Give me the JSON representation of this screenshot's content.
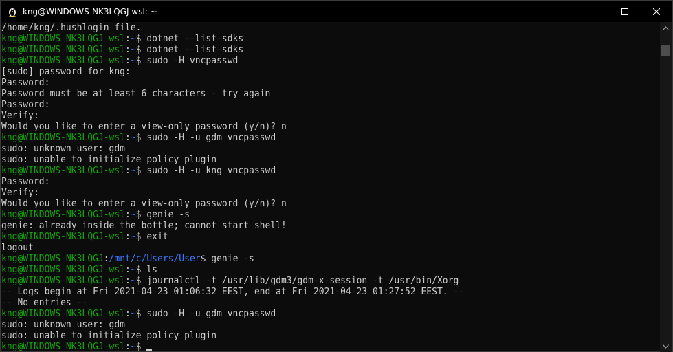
{
  "window": {
    "title": "kng@WINDOWS-NK3LQGJ-wsl: ~",
    "icon": "tux-penguin-icon"
  },
  "caption": {
    "minimize_icon": "minimize-icon",
    "maximize_icon": "maximize-icon",
    "close_icon": "close-icon"
  },
  "terminal": {
    "lines": [
      {
        "segments": [
          {
            "c": "t",
            "text": "/home/kng/.hushlogin file."
          }
        ]
      },
      {
        "segments": [
          {
            "c": "u",
            "text": "kng@WINDOWS-NK3LQGJ-wsl"
          },
          {
            "c": "t",
            "text": ":"
          },
          {
            "c": "p",
            "text": "~"
          },
          {
            "c": "t",
            "text": "$ dotnet --list-sdks"
          }
        ]
      },
      {
        "segments": [
          {
            "c": "u",
            "text": "kng@WINDOWS-NK3LQGJ-wsl"
          },
          {
            "c": "t",
            "text": ":"
          },
          {
            "c": "p",
            "text": "~"
          },
          {
            "c": "t",
            "text": "$ dotnet --list-sdks"
          }
        ]
      },
      {
        "segments": [
          {
            "c": "u",
            "text": "kng@WINDOWS-NK3LQGJ-wsl"
          },
          {
            "c": "t",
            "text": ":"
          },
          {
            "c": "p",
            "text": "~"
          },
          {
            "c": "t",
            "text": "$ sudo -H vncpasswd"
          }
        ]
      },
      {
        "segments": [
          {
            "c": "t",
            "text": "[sudo] password for kng:"
          }
        ]
      },
      {
        "segments": [
          {
            "c": "t",
            "text": "Password:"
          }
        ]
      },
      {
        "segments": [
          {
            "c": "t",
            "text": "Password must be at least 6 characters - try again"
          }
        ]
      },
      {
        "segments": [
          {
            "c": "t",
            "text": "Password:"
          }
        ]
      },
      {
        "segments": [
          {
            "c": "t",
            "text": "Verify:"
          }
        ]
      },
      {
        "segments": [
          {
            "c": "t",
            "text": "Would you like to enter a view-only password (y/n)? n"
          }
        ]
      },
      {
        "segments": [
          {
            "c": "u",
            "text": "kng@WINDOWS-NK3LQGJ-wsl"
          },
          {
            "c": "t",
            "text": ":"
          },
          {
            "c": "p",
            "text": "~"
          },
          {
            "c": "t",
            "text": "$ sudo -H -u gdm vncpasswd"
          }
        ]
      },
      {
        "segments": [
          {
            "c": "t",
            "text": "sudo: unknown user: gdm"
          }
        ]
      },
      {
        "segments": [
          {
            "c": "t",
            "text": "sudo: unable to initialize policy plugin"
          }
        ]
      },
      {
        "segments": [
          {
            "c": "u",
            "text": "kng@WINDOWS-NK3LQGJ-wsl"
          },
          {
            "c": "t",
            "text": ":"
          },
          {
            "c": "p",
            "text": "~"
          },
          {
            "c": "t",
            "text": "$ sudo -H -u kng vncpasswd"
          }
        ]
      },
      {
        "segments": [
          {
            "c": "t",
            "text": "Password:"
          }
        ]
      },
      {
        "segments": [
          {
            "c": "t",
            "text": "Verify:"
          }
        ]
      },
      {
        "segments": [
          {
            "c": "t",
            "text": "Would you like to enter a view-only password (y/n)? n"
          }
        ]
      },
      {
        "segments": [
          {
            "c": "u",
            "text": "kng@WINDOWS-NK3LQGJ-wsl"
          },
          {
            "c": "t",
            "text": ":"
          },
          {
            "c": "p",
            "text": "~"
          },
          {
            "c": "t",
            "text": "$ genie -s"
          }
        ]
      },
      {
        "segments": [
          {
            "c": "t",
            "text": "genie: already inside the bottle; cannot start shell!"
          }
        ]
      },
      {
        "segments": [
          {
            "c": "u",
            "text": "kng@WINDOWS-NK3LQGJ-wsl"
          },
          {
            "c": "t",
            "text": ":"
          },
          {
            "c": "p",
            "text": "~"
          },
          {
            "c": "t",
            "text": "$ exit"
          }
        ]
      },
      {
        "segments": [
          {
            "c": "t",
            "text": "logout"
          }
        ]
      },
      {
        "segments": [
          {
            "c": "u",
            "text": "kng@WINDOWS-NK3LQGJ"
          },
          {
            "c": "t",
            "text": ":"
          },
          {
            "c": "p",
            "text": "/mnt/c/Users/User"
          },
          {
            "c": "t",
            "text": "$ genie -s"
          }
        ]
      },
      {
        "segments": [
          {
            "c": "u",
            "text": "kng@WINDOWS-NK3LQGJ-wsl"
          },
          {
            "c": "t",
            "text": ":"
          },
          {
            "c": "p",
            "text": "~"
          },
          {
            "c": "t",
            "text": "$ ls"
          }
        ]
      },
      {
        "segments": [
          {
            "c": "u",
            "text": "kng@WINDOWS-NK3LQGJ-wsl"
          },
          {
            "c": "t",
            "text": ":"
          },
          {
            "c": "p",
            "text": "~"
          },
          {
            "c": "t",
            "text": "$ journalctl -t /usr/lib/gdm3/gdm-x-session -t /usr/bin/Xorg"
          }
        ]
      },
      {
        "segments": [
          {
            "c": "t",
            "text": "-- Logs begin at Fri 2021-04-23 01:06:32 EEST, end at Fri 2021-04-23 01:27:52 EEST. --"
          }
        ]
      },
      {
        "segments": [
          {
            "c": "t",
            "text": "-- No entries --"
          }
        ]
      },
      {
        "segments": [
          {
            "c": "u",
            "text": "kng@WINDOWS-NK3LQGJ-wsl"
          },
          {
            "c": "t",
            "text": ":"
          },
          {
            "c": "p",
            "text": "~"
          },
          {
            "c": "t",
            "text": "$ sudo -H -u gdm vncpasswd"
          }
        ]
      },
      {
        "segments": [
          {
            "c": "t",
            "text": "sudo: unknown user: gdm"
          }
        ]
      },
      {
        "segments": [
          {
            "c": "t",
            "text": "sudo: unable to initialize policy plugin"
          }
        ]
      },
      {
        "segments": [
          {
            "c": "u",
            "text": "kng@WINDOWS-NK3LQGJ-wsl"
          },
          {
            "c": "t",
            "text": ":"
          },
          {
            "c": "p",
            "text": "~"
          },
          {
            "c": "t",
            "text": "$ "
          }
        ],
        "cursor": true
      }
    ]
  },
  "colors": {
    "background": "#0c0c0c",
    "text": "#cccccc",
    "user_host": "#13a10e",
    "path": "#3b78ff"
  },
  "scrollbar": {
    "up_icon": "scroll-up-arrow-icon",
    "down_icon": "scroll-down-arrow-icon"
  }
}
